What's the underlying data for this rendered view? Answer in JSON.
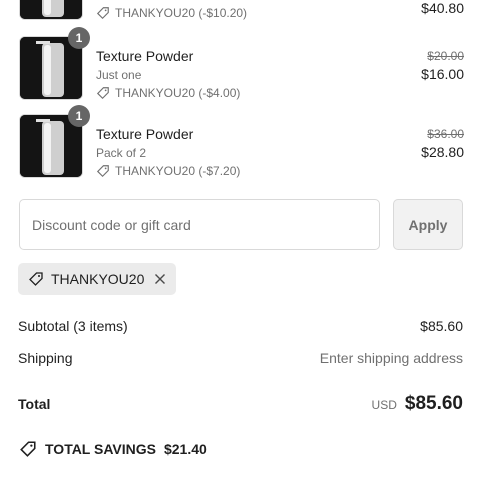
{
  "line_items": [
    {
      "title": "",
      "variant": "",
      "discount": "THANKYOU20 (-$10.20)",
      "price_original": "",
      "price_final": "$40.80",
      "quantity": ""
    },
    {
      "title": "Texture Powder",
      "variant": "Just one",
      "discount": "THANKYOU20 (-$4.00)",
      "price_original": "$20.00",
      "price_final": "$16.00",
      "quantity": "1"
    },
    {
      "title": "Texture Powder",
      "variant": "Pack of 2",
      "discount": "THANKYOU20 (-$7.20)",
      "price_original": "$36.00",
      "price_final": "$28.80",
      "quantity": "1"
    }
  ],
  "discount_field": {
    "placeholder": "Discount code or gift card",
    "value": ""
  },
  "apply_label": "Apply",
  "applied_code": "THANKYOU20",
  "summary": {
    "subtotal_label": "Subtotal (3 items)",
    "subtotal_value": "$85.60",
    "shipping_label": "Shipping",
    "shipping_value": "Enter shipping address",
    "total_label": "Total",
    "currency": "USD",
    "total_value": "$85.60"
  },
  "savings": {
    "label": "TOTAL SAVINGS",
    "value": "$21.40"
  },
  "icons": {
    "tag": "tag-icon",
    "remove": "close-icon",
    "savings": "tag-icon"
  }
}
